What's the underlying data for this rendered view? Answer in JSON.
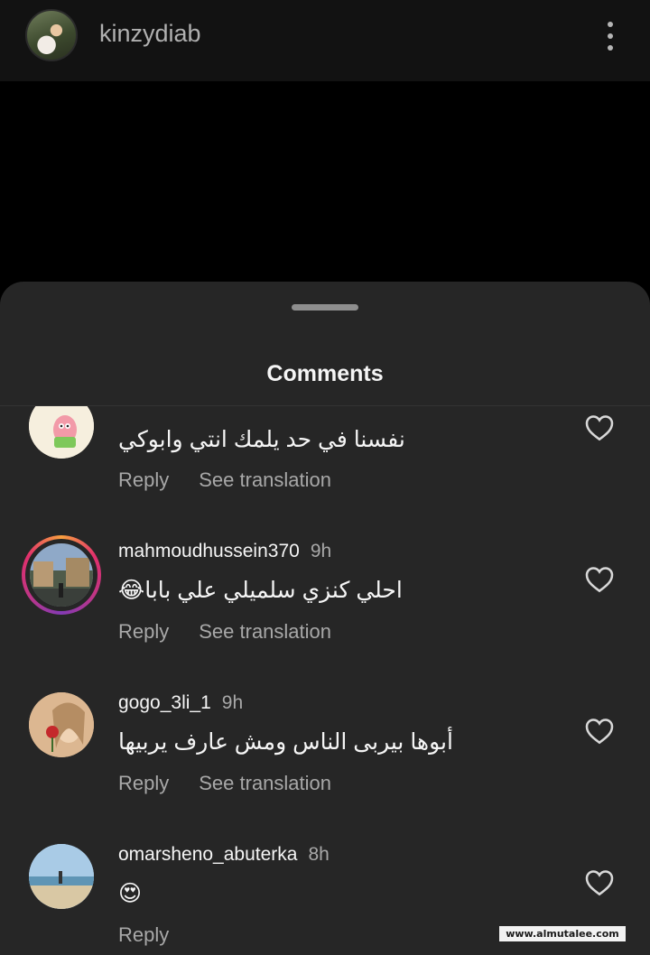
{
  "header": {
    "username": "kinzydiab",
    "menu_icon": "more-vertical-icon"
  },
  "sheet": {
    "title": "Comments"
  },
  "comments": [
    {
      "username": "",
      "time": "",
      "text": "نفسنا في حد يلمك انتي وابوكي",
      "reply_label": "Reply",
      "translate_label": "See translation",
      "has_story_ring": false
    },
    {
      "username": "mahmoudhussein370",
      "time": "9h",
      "text": "احلي كنزي سلميلي علي بابا😂",
      "reply_label": "Reply",
      "translate_label": "See translation",
      "has_story_ring": true
    },
    {
      "username": "gogo_3li_1",
      "time": "9h",
      "text": "أبوها بيربى الناس ومش عارف يربيها",
      "reply_label": "Reply",
      "translate_label": "See translation",
      "has_story_ring": false
    },
    {
      "username": "omarsheno_abuterka",
      "time": "8h",
      "text": "😍",
      "reply_label": "Reply",
      "translate_label": "",
      "has_story_ring": false
    }
  ],
  "watermark": "www.almutalee.com",
  "colors": {
    "background": "#000000",
    "sheet": "#262626",
    "secondary_text": "#a8a8a8",
    "primary_text": "#f5f5f5"
  }
}
